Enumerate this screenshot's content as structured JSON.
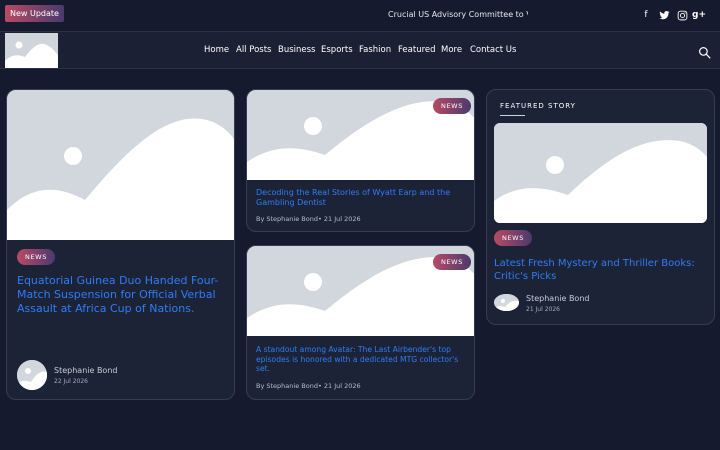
{
  "topbar": {
    "update_badge": "New Update",
    "ticker": "Crucial US Advisory Committee to Vo",
    "social": [
      {
        "name": "facebook-icon",
        "glyph": "f"
      },
      {
        "name": "twitter-icon",
        "glyph": "t"
      },
      {
        "name": "instagram-icon",
        "glyph": "◎"
      },
      {
        "name": "google-plus-icon",
        "glyph": "g+"
      }
    ]
  },
  "nav": {
    "items": [
      "Home",
      "All Posts",
      "Business",
      "Esports",
      "Fashion",
      "Featured",
      "More",
      "Contact Us"
    ]
  },
  "cards": {
    "large": {
      "tag": "NEWS",
      "title": "Equatorial Guinea Duo Handed Four-Match Suspension for Official Verbal Assault at Africa Cup of Nations.",
      "author": "Stephanie Bond",
      "date": "22 Jul 2026"
    },
    "middle_top": {
      "tag": "NEWS",
      "title": "Decoding the Real Stories of Wyatt Earp and the Gambling Dentist",
      "meta": "By Stephanie Bond",
      "date": "• 21 Jul 2026"
    },
    "middle_bottom": {
      "tag": "NEWS",
      "title": "A standout among Avatar: The Last Airbender's top episodes is honored with a dedicated MTG collector's set.",
      "meta": "By Stephanie Bond",
      "date": "• 21 Jul 2026"
    },
    "featured": {
      "label": "FEATURED STORY",
      "tag": "NEWS",
      "title": "Latest Fresh Mystery and Thriller Books: Critic's Picks",
      "author": "Stephanie Bond",
      "date": "21 Jul 2026"
    }
  },
  "colors": {
    "background": "#151a2e",
    "card": "#1d2337",
    "accent_link": "#2f7cf3",
    "tag_gradient_start": "#b84a63",
    "tag_gradient_end": "#4a3a6e"
  }
}
